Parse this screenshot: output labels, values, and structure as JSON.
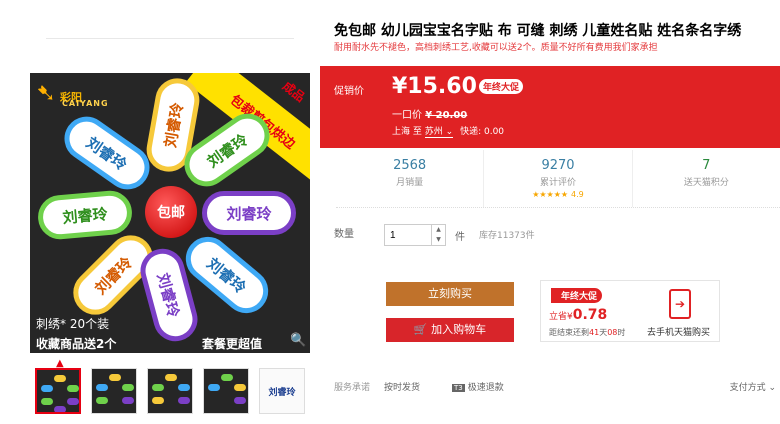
{
  "product": {
    "title": "免包邮 幼儿园宝宝名字贴 布 可缝 刺绣 儿童姓名贴 姓名条名字绣",
    "subtitle": "耐用耐水先不褪色，高档刺绣工艺,收藏可以送2个。质量不好所有费用我们家承担"
  },
  "gallery": {
    "brand": "彩阳",
    "brand_sub": "CAIYANG",
    "ribbon_text": "包裁剪包烘边",
    "ribbon_top": "成品",
    "tag_text": "刘睿玲",
    "center_badge": "包邮",
    "caption_left_1": "刺绣* 20个装",
    "caption_left_2": "收藏商品送2个",
    "caption_right": "套餐更超值",
    "zoom_icon": "magnifier-icon",
    "thumb_text": "刘睿玲",
    "caret": "▲"
  },
  "price": {
    "label": "促销价",
    "value": "¥15.60",
    "badge": "年终大促",
    "orig_label": "一口价",
    "orig_value": "¥ 20.00",
    "ship_from": "上海",
    "ship_to_label": "至",
    "ship_to": "苏州",
    "ship_fee": "快递: 0.00"
  },
  "stats": [
    {
      "num": "2568",
      "name": "月销量"
    },
    {
      "num": "9270",
      "name": "累计评价",
      "stars": "★★★★★",
      "score": "4.9"
    },
    {
      "num": "7",
      "name": "送天猫积分"
    }
  ],
  "quantity": {
    "label": "数量",
    "value": "1",
    "unit": "件",
    "stock": "库存11373件"
  },
  "actions": {
    "buy": "立刻购买",
    "cart": "加入购物车"
  },
  "promo_box": {
    "tag": "年终大促",
    "save_prefix": "立省¥",
    "save_value": "0.78",
    "time_prefix": "距结束还剩",
    "time_days": "41",
    "time_days_unit": "天",
    "time_hours": "08",
    "time_hours_unit": "时",
    "phone_label": "去手机天猫购买"
  },
  "footer": {
    "service": "服务承诺",
    "fast": "按时发货",
    "refund_icon": "T3",
    "refund": "极速退款",
    "pay": "支付方式"
  },
  "colors": {
    "accent_red": "#e02224",
    "buy_orange": "#c0722b",
    "gallery_bg": "#262626",
    "ribbon_yellow": "#ffe100"
  }
}
